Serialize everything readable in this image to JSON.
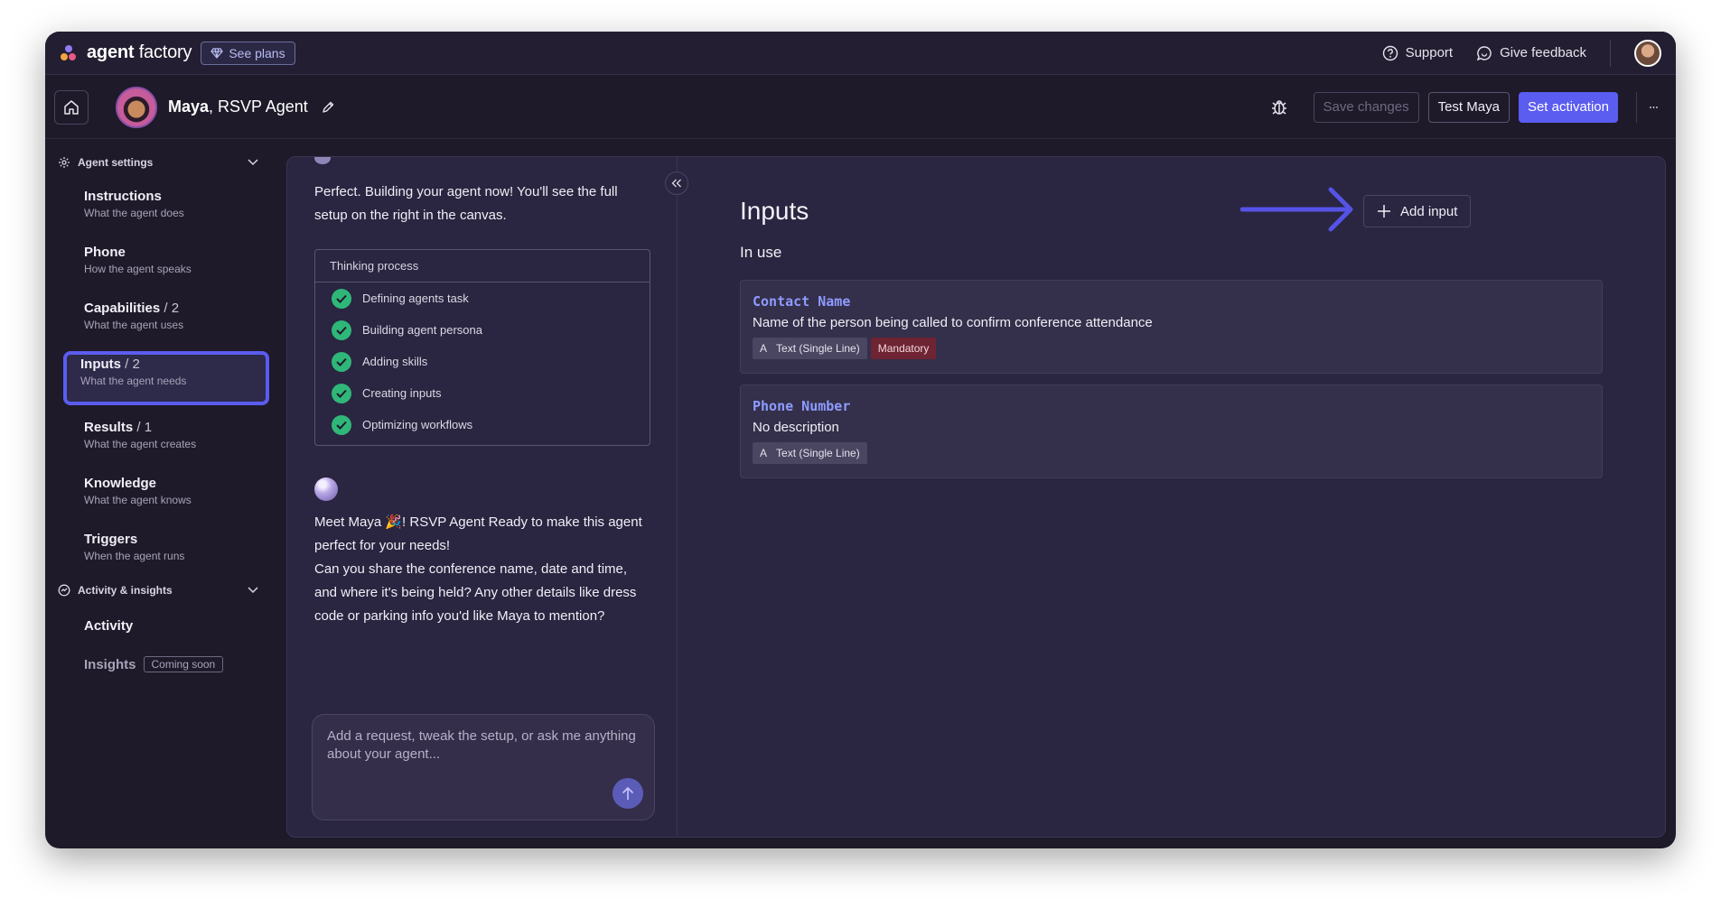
{
  "app": {
    "brand_prefix": "agent",
    "brand_suffix": " factory",
    "see_plans": "See plans",
    "support": "Support",
    "feedback": "Give feedback",
    "accent_color": "#5b5cf0"
  },
  "agent": {
    "name": "Maya",
    "role": ", RSVP Agent",
    "save_label": "Save changes",
    "test_label": "Test Maya",
    "activate_label": "Set activation"
  },
  "sidebar": {
    "agent_settings": "Agent settings",
    "items": [
      {
        "title": "Instructions",
        "count": "",
        "sub": "What the agent does"
      },
      {
        "title": "Phone",
        "count": "",
        "sub": "How the agent speaks"
      },
      {
        "title": "Capabilities",
        "count": " / 2",
        "sub": "What the agent uses"
      },
      {
        "title": "Inputs",
        "count": " / 2",
        "sub": "What the agent needs"
      },
      {
        "title": "Results",
        "count": " / 1",
        "sub": "What the agent creates"
      },
      {
        "title": "Knowledge",
        "count": "",
        "sub": "What the agent knows"
      },
      {
        "title": "Triggers",
        "count": "",
        "sub": "When the agent runs"
      }
    ],
    "activity_section": "Activity & insights",
    "activity": "Activity",
    "insights": "Insights",
    "coming_soon": "Coming soon"
  },
  "chat": {
    "message1": "Perfect. Building your agent now! You'll see the full setup on the right in the canvas.",
    "thinking_title": "Thinking process",
    "steps": [
      "Defining agents task",
      "Building agent persona",
      "Adding skills",
      "Creating inputs",
      "Optimizing workflows"
    ],
    "message2_line1": "Meet Maya 🎉! RSVP Agent Ready to make this agent perfect for your needs!",
    "message2_line2": "Can you share the conference name, date and time, and where it's being held? Any other details like dress code or parking info you'd like Maya to mention?",
    "input_placeholder": "Add a request, tweak the setup, or ask me anything about your agent..."
  },
  "canvas": {
    "title": "Inputs",
    "add_input": "Add input",
    "in_use": "In use",
    "inputs": [
      {
        "name": "Contact Name",
        "description": "Name of the person being called to confirm conference attendance",
        "type": "Text (Single Line)",
        "type_glyph": "A",
        "mandatory": "Mandatory"
      },
      {
        "name": "Phone Number",
        "description": "No description",
        "type": "Text (Single Line)",
        "type_glyph": "A"
      }
    ]
  }
}
